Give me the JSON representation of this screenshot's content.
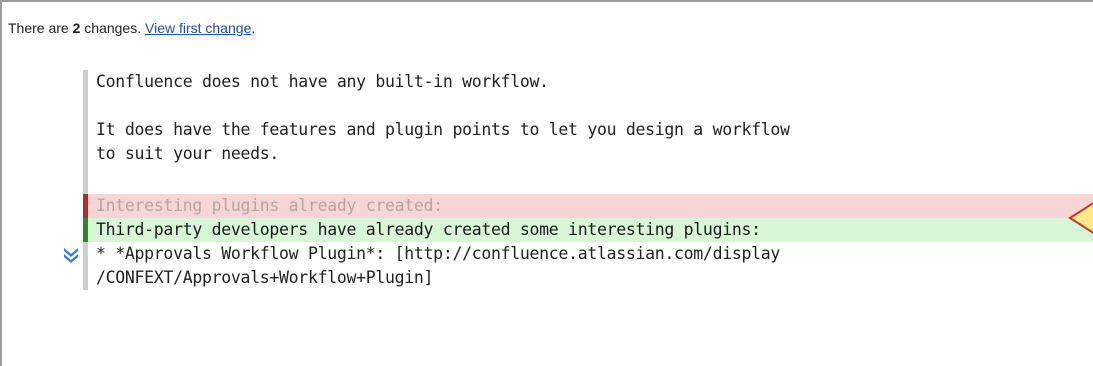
{
  "summary": {
    "prefix": "There are ",
    "count": "2",
    "suffix": " changes. ",
    "link": "View first change",
    "end": "."
  },
  "diff": {
    "lines": [
      "Confluence does not have any built-in workflow.",
      "",
      "It does have the features and plugin points to let you design a workflow",
      "to suit your needs.",
      "",
      "Interesting plugins already created:",
      "Third-party developers have already created some interesting plugins:",
      "* *Approvals Workflow Plugin*: [http://confluence.atlassian.com/display",
      "/CONFEXT/Approvals+Workflow+Plugin]"
    ]
  },
  "icons": {
    "jump": "double-chevron-down-icon",
    "marker": "arrow-marker-icon"
  },
  "colors": {
    "removed_bg": "#f6d5d5",
    "removed_bar": "#b52a2a",
    "added_bg": "#d8f5d8",
    "added_bar": "#2a8a2a",
    "link": "#1f4fb3",
    "marker_fill": "#fde98a",
    "marker_stroke": "#c4372a"
  }
}
